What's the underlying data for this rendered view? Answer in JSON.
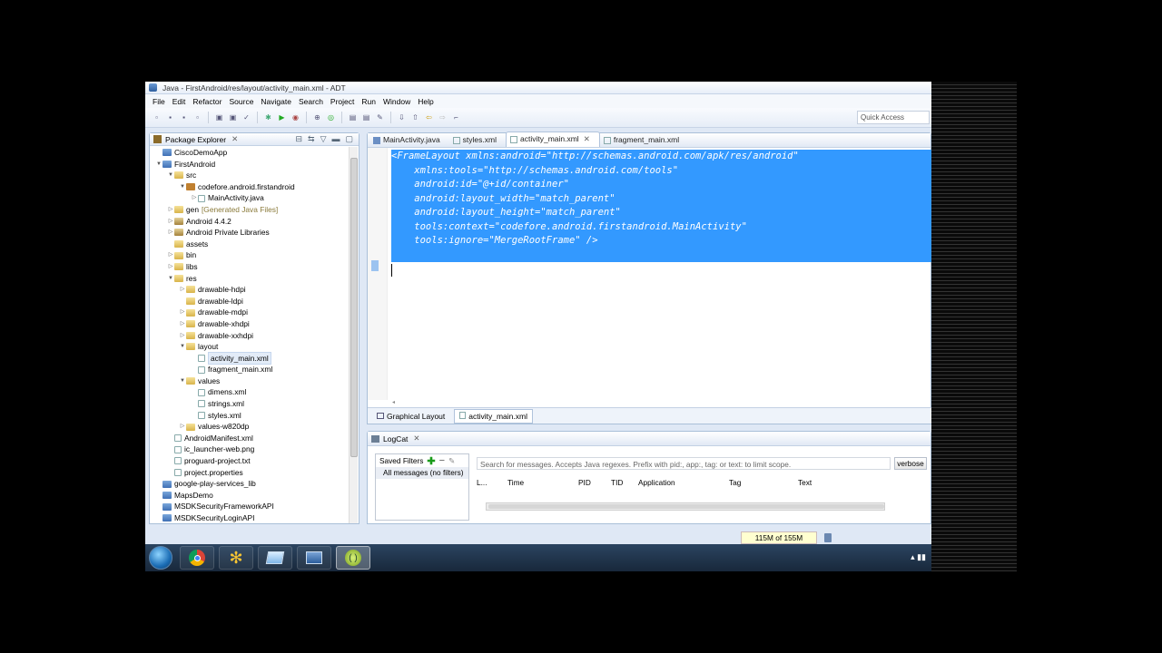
{
  "window": {
    "title": "Java - FirstAndroid/res/layout/activity_main.xml - ADT"
  },
  "menu": [
    "File",
    "Edit",
    "Refactor",
    "Source",
    "Navigate",
    "Search",
    "Project",
    "Run",
    "Window",
    "Help"
  ],
  "toolbar": {
    "quick_access_placeholder": "Quick Access"
  },
  "package_explorer": {
    "title": "Package Explorer",
    "items": [
      {
        "label": "CiscoDemoApp",
        "depth": 0,
        "arrow": "",
        "icon": "proj"
      },
      {
        "label": "FirstAndroid",
        "depth": 0,
        "arrow": "▼",
        "icon": "proj"
      },
      {
        "label": "src",
        "depth": 1,
        "arrow": "▼",
        "icon": "folder"
      },
      {
        "label": "codefore.android.firstandroid",
        "depth": 2,
        "arrow": "▼",
        "icon": "pkg"
      },
      {
        "label": "MainActivity.java",
        "depth": 3,
        "arrow": "▷",
        "icon": "file"
      },
      {
        "label": "gen",
        "depth": 1,
        "arrow": "▷",
        "icon": "folder",
        "decoration": "[Generated Java Files]"
      },
      {
        "label": "Android 4.4.2",
        "depth": 1,
        "arrow": "▷",
        "icon": "lib"
      },
      {
        "label": "Android Private Libraries",
        "depth": 1,
        "arrow": "▷",
        "icon": "lib"
      },
      {
        "label": "assets",
        "depth": 1,
        "arrow": "",
        "icon": "folder"
      },
      {
        "label": "bin",
        "depth": 1,
        "arrow": "▷",
        "icon": "folder"
      },
      {
        "label": "libs",
        "depth": 1,
        "arrow": "▷",
        "icon": "folder"
      },
      {
        "label": "res",
        "depth": 1,
        "arrow": "▼",
        "icon": "folder"
      },
      {
        "label": "drawable-hdpi",
        "depth": 2,
        "arrow": "▷",
        "icon": "folder"
      },
      {
        "label": "drawable-ldpi",
        "depth": 2,
        "arrow": "",
        "icon": "folder"
      },
      {
        "label": "drawable-mdpi",
        "depth": 2,
        "arrow": "▷",
        "icon": "folder"
      },
      {
        "label": "drawable-xhdpi",
        "depth": 2,
        "arrow": "▷",
        "icon": "folder"
      },
      {
        "label": "drawable-xxhdpi",
        "depth": 2,
        "arrow": "▷",
        "icon": "folder"
      },
      {
        "label": "layout",
        "depth": 2,
        "arrow": "▼",
        "icon": "folder"
      },
      {
        "label": "activity_main.xml",
        "depth": 3,
        "arrow": "",
        "icon": "file",
        "selected": true
      },
      {
        "label": "fragment_main.xml",
        "depth": 3,
        "arrow": "",
        "icon": "file"
      },
      {
        "label": "values",
        "depth": 2,
        "arrow": "▼",
        "icon": "folder"
      },
      {
        "label": "dimens.xml",
        "depth": 3,
        "arrow": "",
        "icon": "file"
      },
      {
        "label": "strings.xml",
        "depth": 3,
        "arrow": "",
        "icon": "file"
      },
      {
        "label": "styles.xml",
        "depth": 3,
        "arrow": "",
        "icon": "file"
      },
      {
        "label": "values-w820dp",
        "depth": 2,
        "arrow": "▷",
        "icon": "folder"
      },
      {
        "label": "AndroidManifest.xml",
        "depth": 1,
        "arrow": "",
        "icon": "file"
      },
      {
        "label": "ic_launcher-web.png",
        "depth": 1,
        "arrow": "",
        "icon": "file"
      },
      {
        "label": "proguard-project.txt",
        "depth": 1,
        "arrow": "",
        "icon": "file"
      },
      {
        "label": "project.properties",
        "depth": 1,
        "arrow": "",
        "icon": "file"
      },
      {
        "label": "google-play-services_lib",
        "depth": 0,
        "arrow": "",
        "icon": "proj"
      },
      {
        "label": "MapsDemo",
        "depth": 0,
        "arrow": "",
        "icon": "proj"
      },
      {
        "label": "MSDKSecurityFrameworkAPI",
        "depth": 0,
        "arrow": "",
        "icon": "proj"
      },
      {
        "label": "MSDKSecurityLoginAPI",
        "depth": 0,
        "arrow": "",
        "icon": "proj"
      }
    ]
  },
  "editor": {
    "tabs": [
      {
        "label": "MainActivity.java",
        "active": false
      },
      {
        "label": "styles.xml",
        "active": false
      },
      {
        "label": "activity_main.xml",
        "active": true
      },
      {
        "label": "fragment_main.xml",
        "active": false
      }
    ],
    "code_lines": [
      "<FrameLayout xmlns:android=\"http://schemas.android.com/apk/res/android\"",
      "    xmlns:tools=\"http://schemas.android.com/tools\"",
      "    android:id=\"@+id/container\"",
      "    android:layout_width=\"match_parent\"",
      "    android:layout_height=\"match_parent\"",
      "    tools:context=\"codefore.android.firstandroid.MainActivity\"",
      "    tools:ignore=\"MergeRootFrame\" />"
    ],
    "bottom_tabs": [
      "Graphical Layout",
      "activity_main.xml"
    ]
  },
  "logcat": {
    "title": "LogCat",
    "saved_filters_label": "Saved Filters",
    "filters": [
      "All messages (no filters)"
    ],
    "search_placeholder": "Search for messages. Accepts Java regexes. Prefix with pid:, app:, tag: or text: to limit scope.",
    "level": "verbose",
    "columns": [
      "L...",
      "Time",
      "PID",
      "TID",
      "Application",
      "Tag",
      "Text"
    ]
  },
  "status": {
    "heap": "115M of 155M"
  },
  "colors": {
    "selection": "#3399ff",
    "chrome": "#dfe8f5"
  }
}
